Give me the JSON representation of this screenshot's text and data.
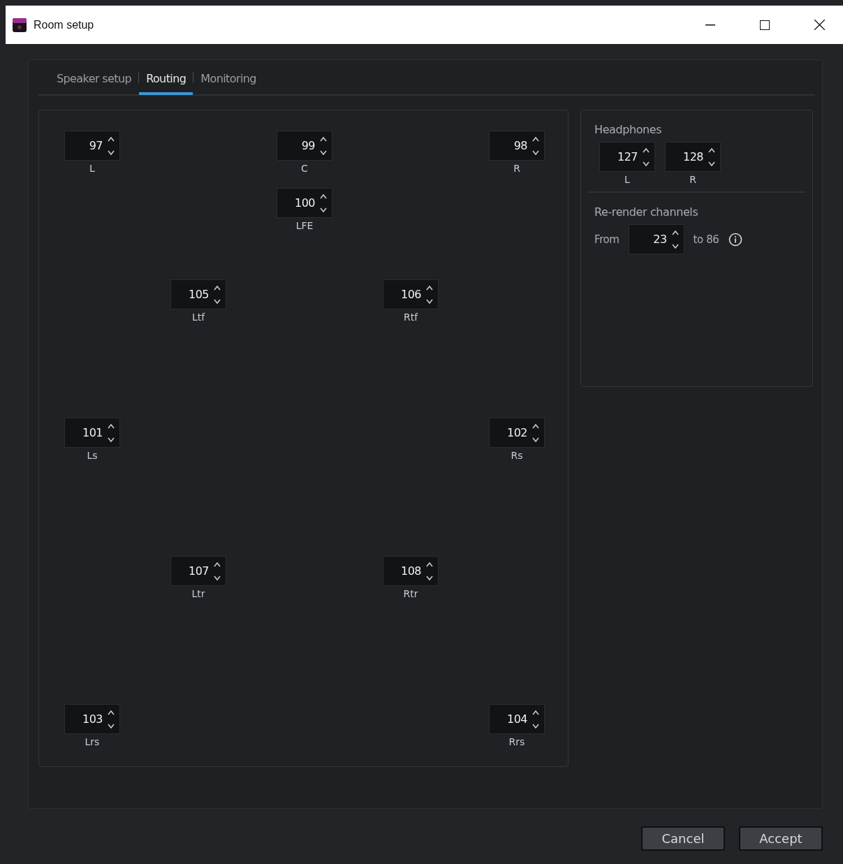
{
  "window": {
    "title": "Room setup"
  },
  "tabs": [
    {
      "label": "Speaker setup",
      "selected": false
    },
    {
      "label": "Routing",
      "selected": true
    },
    {
      "label": "Monitoring",
      "selected": false
    }
  ],
  "speakers": [
    {
      "value": "97",
      "label": "L"
    },
    {
      "value": "99",
      "label": "C"
    },
    {
      "value": "98",
      "label": "R"
    },
    {
      "value": "100",
      "label": "LFE"
    },
    {
      "value": "105",
      "label": "Ltf"
    },
    {
      "value": "106",
      "label": "Rtf"
    },
    {
      "value": "101",
      "label": "Ls"
    },
    {
      "value": "102",
      "label": "Rs"
    },
    {
      "value": "107",
      "label": "Ltr"
    },
    {
      "value": "108",
      "label": "Rtr"
    },
    {
      "value": "103",
      "label": "Lrs"
    },
    {
      "value": "104",
      "label": "Rrs"
    }
  ],
  "headphones": {
    "title": "Headphones",
    "channels": [
      {
        "value": "127",
        "label": "L"
      },
      {
        "value": "128",
        "label": "R"
      }
    ]
  },
  "rerender": {
    "title": "Re-render channels",
    "from_label": "From",
    "from_value": "23",
    "to_text": "to 86"
  },
  "buttons": [
    "Cancel",
    "Accept"
  ]
}
